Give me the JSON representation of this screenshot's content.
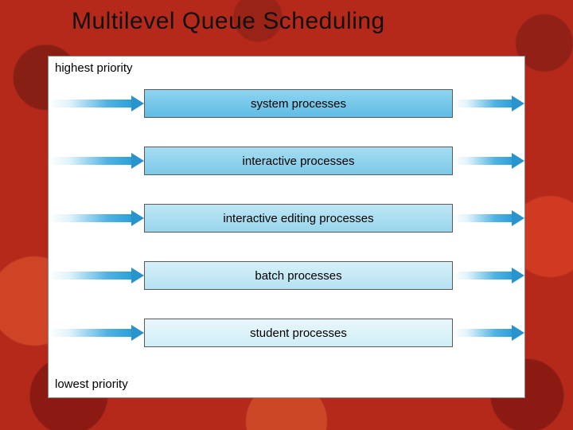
{
  "title": "Multilevel Queue Scheduling",
  "priority_top": "highest priority",
  "priority_bottom": "lowest priority",
  "queues": {
    "q0": "system processes",
    "q1": "interactive processes",
    "q2": "interactive editing processes",
    "q3": "batch processes",
    "q4": "student processes"
  }
}
